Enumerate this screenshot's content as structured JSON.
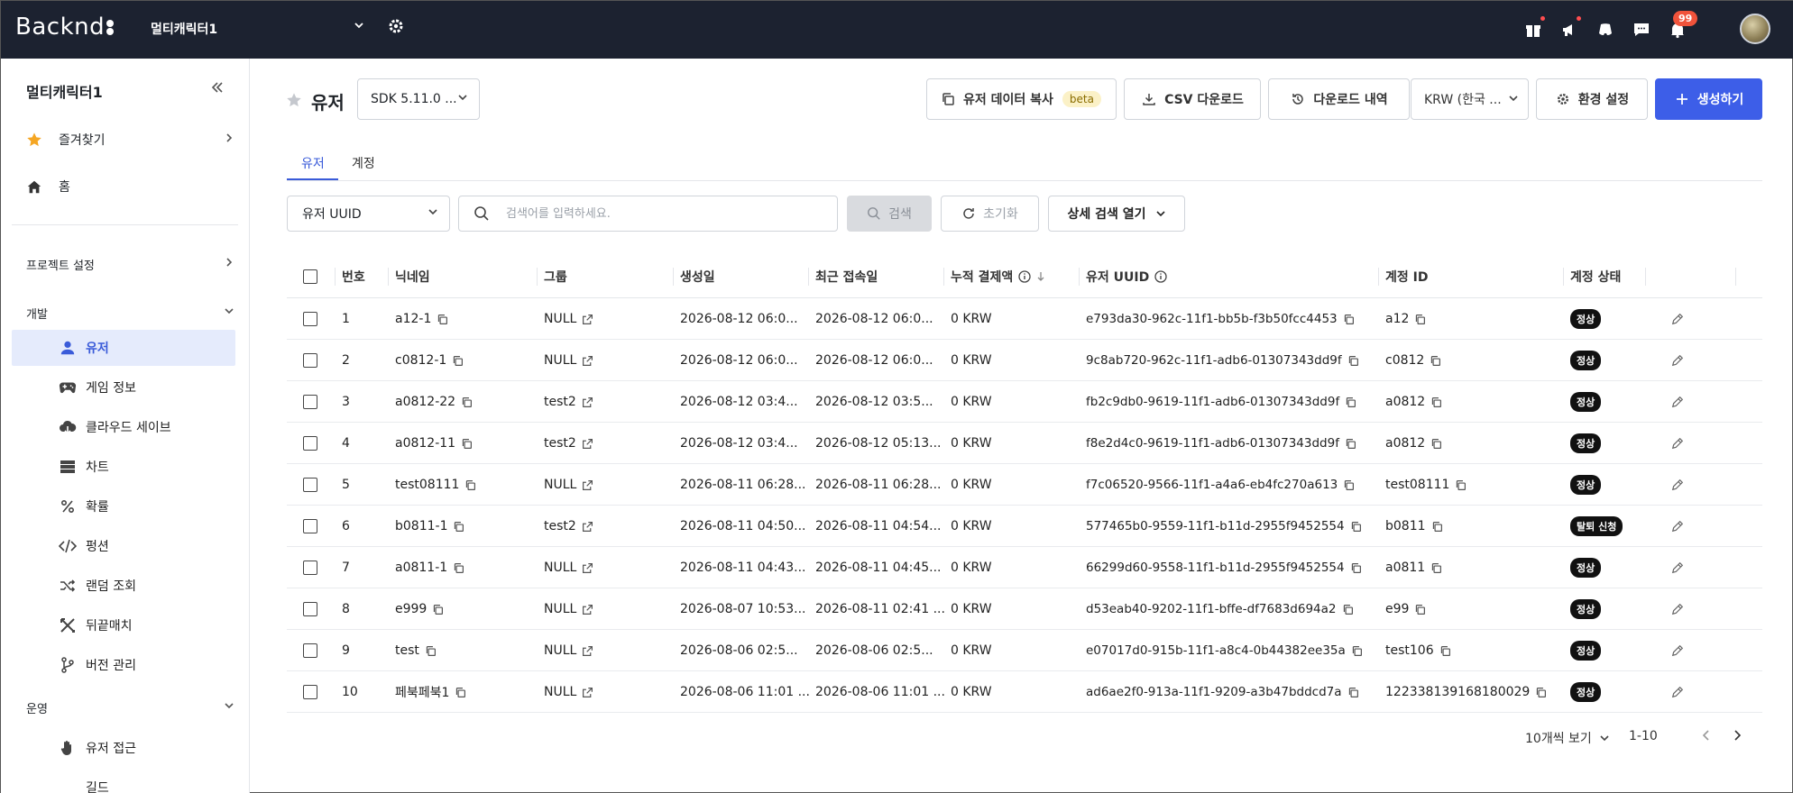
{
  "app": {
    "logo": "Backnd"
  },
  "topbar": {
    "project_name": "멀티캐릭터1",
    "notification_count": "99"
  },
  "sidebar": {
    "title": "멀티캐릭터1",
    "favorites": "즐겨찾기",
    "home": "홈",
    "project_settings": "프로젝트 설정",
    "dev_section": "개발",
    "items": [
      {
        "label": "유저",
        "icon": "user-icon"
      },
      {
        "label": "게임 정보",
        "icon": "gamepad-icon"
      },
      {
        "label": "클라우드 세이브",
        "icon": "cloud-icon"
      },
      {
        "label": "차트",
        "icon": "chart-icon"
      },
      {
        "label": "확률",
        "icon": "percent-icon"
      },
      {
        "label": "펑션",
        "icon": "code-icon"
      },
      {
        "label": "랜덤 조회",
        "icon": "shuffle-icon"
      },
      {
        "label": "뒤끝매치",
        "icon": "match-icon"
      },
      {
        "label": "버전 관리",
        "icon": "branch-icon"
      }
    ],
    "ops_section": "운영",
    "ops_items": [
      {
        "label": "유저 접근",
        "icon": "hand-icon"
      },
      {
        "label": "길드",
        "icon": "guild-icon"
      }
    ]
  },
  "header": {
    "title": "유저",
    "sdk_version": "SDK 5.11.0 ...",
    "copy_data": "유저 데이터 복사",
    "beta": "beta",
    "csv_download": "CSV 다운로드",
    "download_history": "다운로드 내역",
    "currency": "KRW (한국 ...",
    "env_settings": "환경 설정",
    "create": "생성하기"
  },
  "tabs": [
    {
      "label": "유저"
    },
    {
      "label": "계정"
    }
  ],
  "search": {
    "filter": "유저 UUID",
    "placeholder": "검색어를 입력하세요.",
    "search_btn": "검색",
    "reset_btn": "초기화",
    "detail_btn": "상세 검색 열기"
  },
  "table": {
    "columns": [
      "번호",
      "닉네임",
      "그룹",
      "생성일",
      "최근 접속일",
      "누적 결제액",
      "유저 UUID",
      "계정 ID",
      "계정 상태"
    ],
    "rows": [
      {
        "no": "1",
        "nick": "a12-1",
        "group": "NULL",
        "created": "2026-08-12 06:0...",
        "last": "2026-08-12 06:0...",
        "paid": "0 KRW",
        "uuid": "e793da30-962c-11f1-bb5b-f3b50fcc4453",
        "account": "a12",
        "status": "정상"
      },
      {
        "no": "2",
        "nick": "c0812-1",
        "group": "NULL",
        "created": "2026-08-12 06:0...",
        "last": "2026-08-12 06:0...",
        "paid": "0 KRW",
        "uuid": "9c8ab720-962c-11f1-adb6-01307343dd9f",
        "account": "c0812",
        "status": "정상"
      },
      {
        "no": "3",
        "nick": "a0812-22",
        "group": "test2",
        "created": "2026-08-12 03:4...",
        "last": "2026-08-12 03:5...",
        "paid": "0 KRW",
        "uuid": "fb2c9db0-9619-11f1-adb6-01307343dd9f",
        "account": "a0812",
        "status": "정상"
      },
      {
        "no": "4",
        "nick": "a0812-11",
        "group": "test2",
        "created": "2026-08-12 03:4...",
        "last": "2026-08-12 05:13...",
        "paid": "0 KRW",
        "uuid": "f8e2d4c0-9619-11f1-adb6-01307343dd9f",
        "account": "a0812",
        "status": "정상"
      },
      {
        "no": "5",
        "nick": "test08111",
        "group": "NULL",
        "created": "2026-08-11 06:28...",
        "last": "2026-08-11 06:28...",
        "paid": "0 KRW",
        "uuid": "f7c06520-9566-11f1-a4a6-eb4fc270a613",
        "account": "test08111",
        "status": "정상"
      },
      {
        "no": "6",
        "nick": "b0811-1",
        "group": "test2",
        "created": "2026-08-11 04:50...",
        "last": "2026-08-11 04:54...",
        "paid": "0 KRW",
        "uuid": "577465b0-9559-11f1-b11d-2955f9452554",
        "account": "b0811",
        "status": "탈퇴 신청"
      },
      {
        "no": "7",
        "nick": "a0811-1",
        "group": "NULL",
        "created": "2026-08-11 04:43...",
        "last": "2026-08-11 04:45...",
        "paid": "0 KRW",
        "uuid": "66299d60-9558-11f1-b11d-2955f9452554",
        "account": "a0811",
        "status": "정상"
      },
      {
        "no": "8",
        "nick": "e999",
        "group": "NULL",
        "created": "2026-08-07 10:53...",
        "last": "2026-08-11 02:41 ...",
        "paid": "0 KRW",
        "uuid": "d53eab40-9202-11f1-bffe-df7683d694a2",
        "account": "e99",
        "status": "정상"
      },
      {
        "no": "9",
        "nick": "test",
        "group": "NULL",
        "created": "2026-08-06 02:5...",
        "last": "2026-08-06 02:5...",
        "paid": "0 KRW",
        "uuid": "e07017d0-915b-11f1-a8c4-0b44382ee35a",
        "account": "test106",
        "status": "정상"
      },
      {
        "no": "10",
        "nick": "페북페북1",
        "group": "NULL",
        "created": "2026-08-06 11:01 ...",
        "last": "2026-08-06 11:01 ...",
        "paid": "0 KRW",
        "uuid": "ad6ae2f0-913a-11f1-9209-a3b47bddcd7a",
        "account": "122338139168180029",
        "status": "정상"
      }
    ]
  },
  "pagination": {
    "page_size": "10개씩 보기",
    "range": "1-10"
  }
}
